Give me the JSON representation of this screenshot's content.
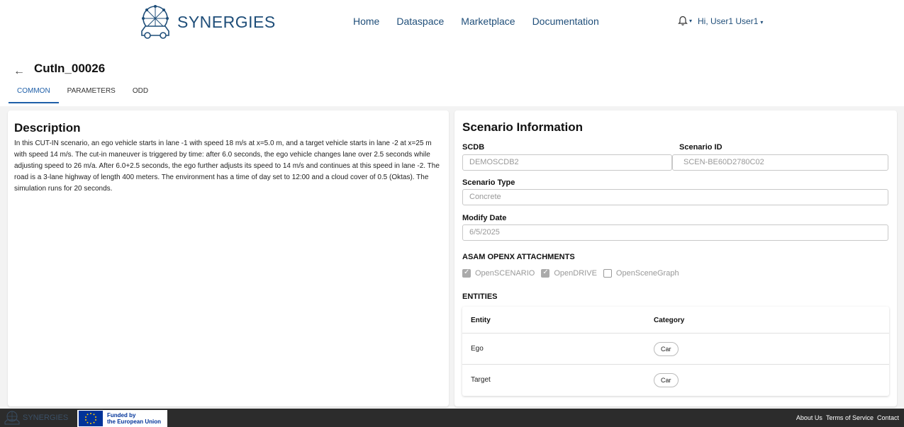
{
  "brand": {
    "name": "SYNERGIES"
  },
  "nav": {
    "items": [
      "Home",
      "Dataspace",
      "Marketplace",
      "Documentation"
    ]
  },
  "user": {
    "greeting": "Hi, User1 User1"
  },
  "page": {
    "title": "CutIn_00026",
    "tabs": [
      {
        "label": "COMMON",
        "active": true
      },
      {
        "label": "PARAMETERS",
        "active": false
      },
      {
        "label": "ODD",
        "active": false
      }
    ]
  },
  "description": {
    "heading": "Description",
    "text": "In this CUT-IN scenario, an ego vehicle starts in lane -1 with speed 18 m/s at x=5.0 m, and a target vehicle starts in lane -2 at x=25 m with speed 14 m/s. The cut-in maneuver is triggered by time: after 6.0 seconds, the ego vehicle changes lane over 2.5 seconds while adjusting speed to 26 m/a. After 6.0+2.5 seconds, the ego further adjusts its speed to 14 m/s and continues at this speed in lane -2. The road is a 3-lane highway of length 400 meters. The environment has a time of day set to 12:00 and a cloud cover of 0.5 (Oktas). The simulation runs for 20 seconds."
  },
  "scenario_info": {
    "heading": "Scenario Information",
    "scdb_label": "SCDB",
    "scdb_value": "DEMOSCDB2",
    "id_label": "Scenario ID",
    "id_value": "SCEN-BE60D2780C02",
    "type_label": "Scenario Type",
    "type_value": "Concrete",
    "date_label": "Modify Date",
    "date_value": "6/5/2025",
    "attachments_label": "ASAM OPENX ATTACHMENTS",
    "attachments": [
      {
        "label": "OpenSCENARIO",
        "checked": true
      },
      {
        "label": "OpenDRIVE",
        "checked": true
      },
      {
        "label": "OpenSceneGraph",
        "checked": false
      }
    ],
    "entities_label": "ENTITIES",
    "entities_columns": [
      "Entity",
      "Category"
    ],
    "entities_rows": [
      {
        "entity": "Ego",
        "category": "Car"
      },
      {
        "entity": "Target",
        "category": "Car"
      }
    ]
  },
  "footer": {
    "logo_text": "SYNERGIES",
    "eu_line1": "Funded by",
    "eu_line2": "the European Union",
    "links": [
      "About Us",
      "Terms of Service",
      "Contact"
    ]
  },
  "colors": {
    "brand": "#1f4e79",
    "accent": "#1f5fa8",
    "footer": "#2c2c2c",
    "eu_blue": "#003399"
  }
}
